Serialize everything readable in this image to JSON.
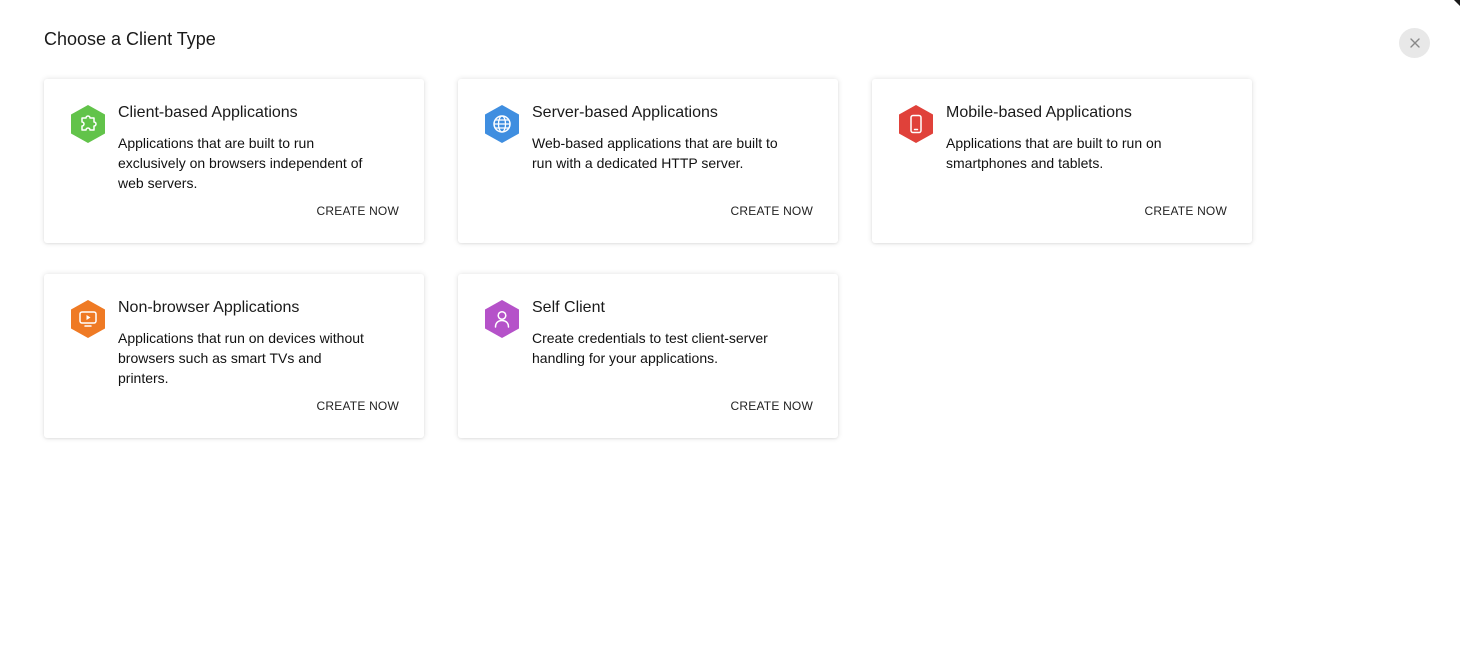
{
  "header": {
    "title": "Choose a Client Type",
    "close_icon": "close-icon"
  },
  "cards": [
    {
      "title": "Client-based Applications",
      "description": "Applications that are built to run exclusively on browsers independent of web servers.",
      "action": "CREATE NOW",
      "icon": "puzzle-icon",
      "color": "#62c34a"
    },
    {
      "title": "Server-based Applications",
      "description": "Web-based applications that are built to run with a dedicated HTTP server.",
      "action": "CREATE NOW",
      "icon": "globe-icon",
      "color": "#3f8ee0"
    },
    {
      "title": "Mobile-based Applications",
      "description": "Applications that are built to run on smartphones and tablets.",
      "action": "CREATE NOW",
      "icon": "mobile-icon",
      "color": "#e0413a"
    },
    {
      "title": "Non-browser Applications",
      "description": "Applications that run on devices without browsers such as smart TVs and printers.",
      "action": "CREATE NOW",
      "icon": "tv-icon",
      "color": "#ef7a24"
    },
    {
      "title": "Self Client",
      "description": "Create credentials to test client-server handling for your applications.",
      "action": "CREATE NOW",
      "icon": "user-icon",
      "color": "#b552c9"
    }
  ]
}
